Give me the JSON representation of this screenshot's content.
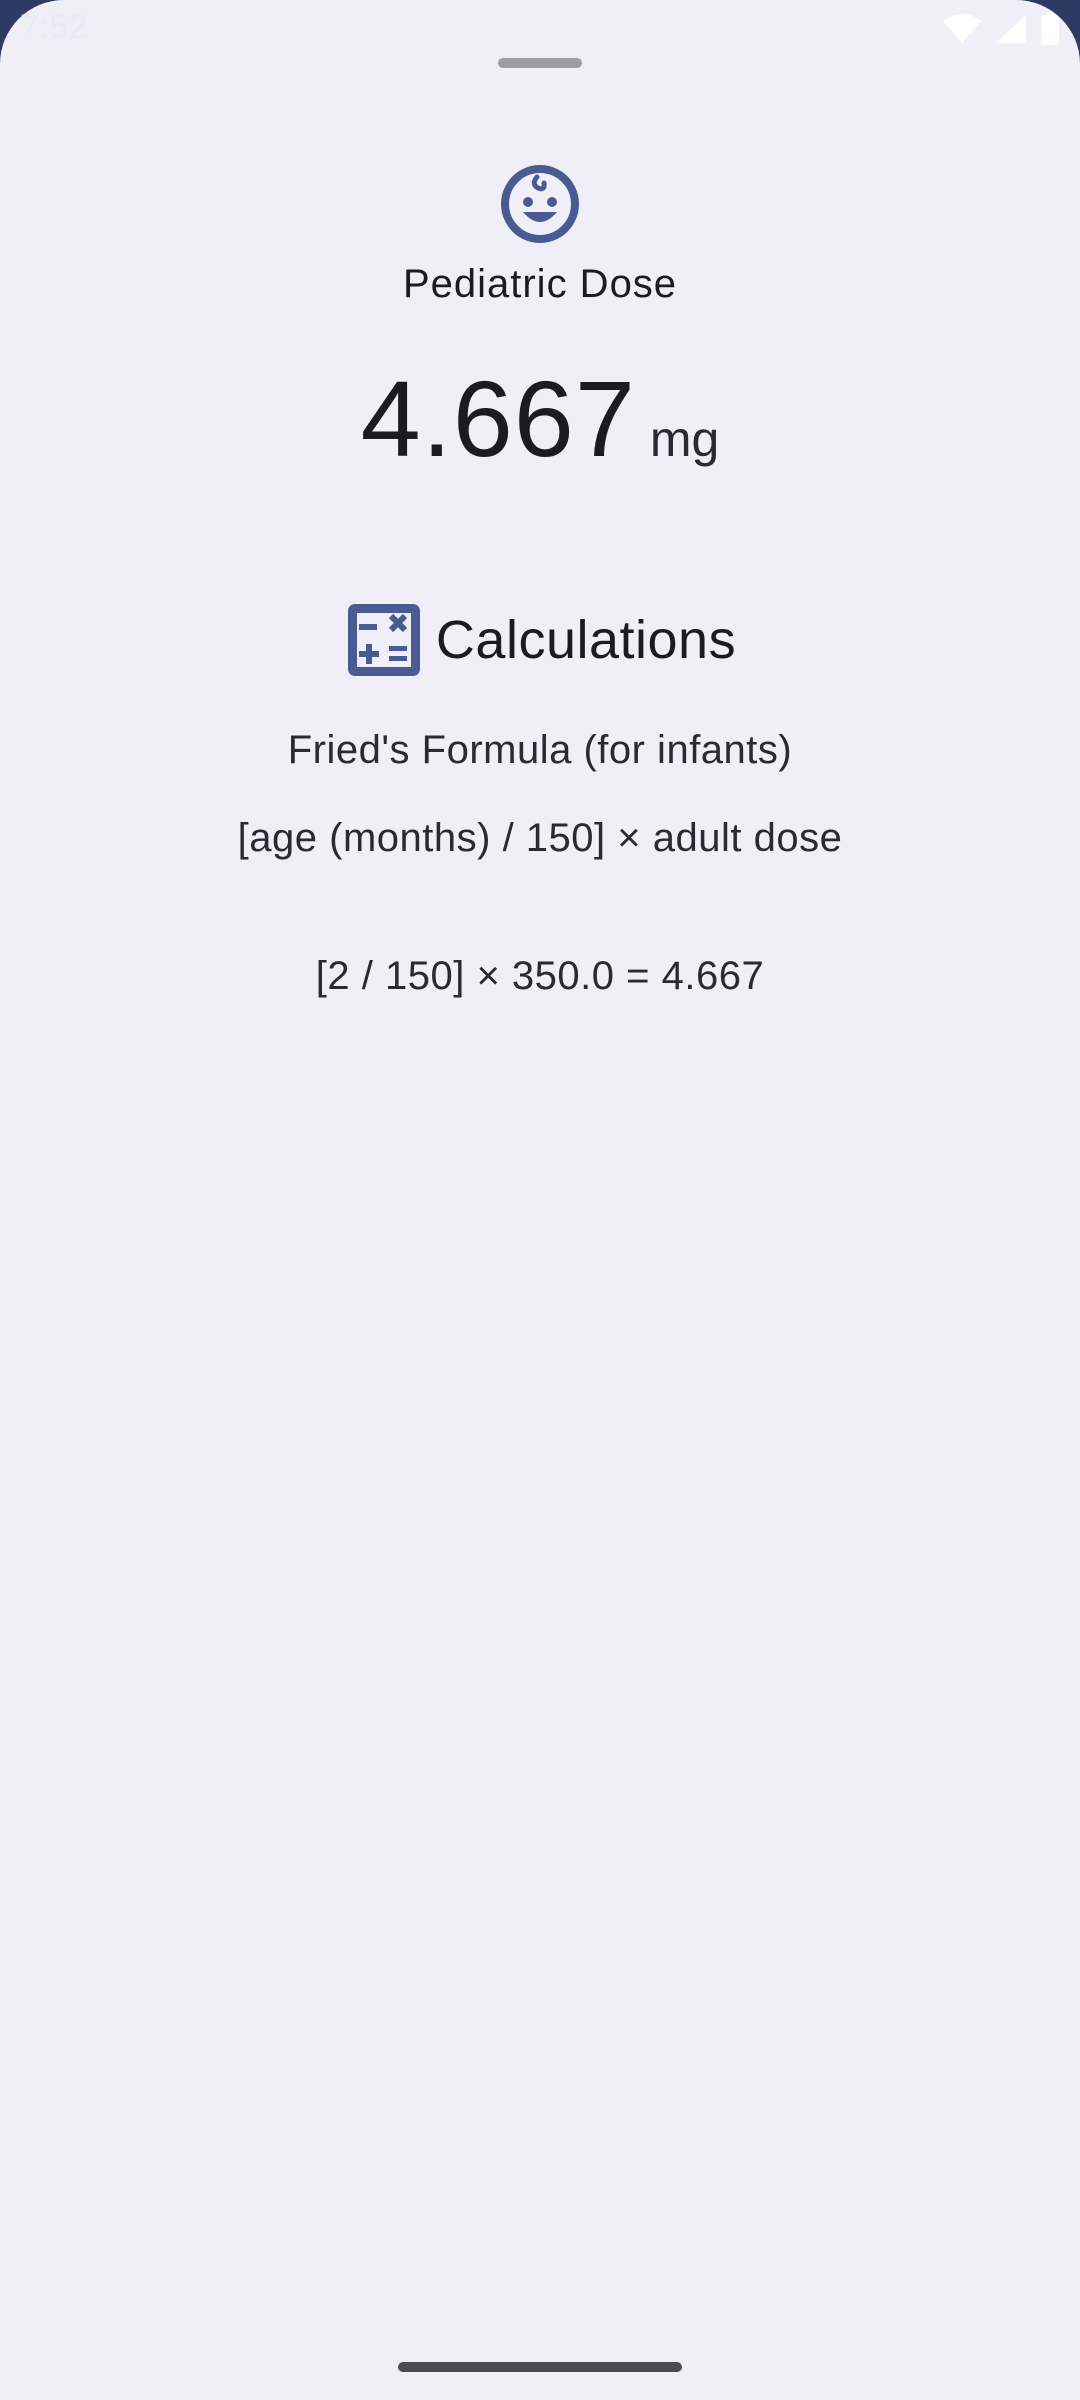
{
  "status_bar": {
    "time": "7:52",
    "icons": [
      "wifi-icon",
      "cellular-signal-icon",
      "battery-icon"
    ]
  },
  "sheet": {
    "icon": "baby-face-icon",
    "title": "Pediatric Dose",
    "result": {
      "value": "4.667",
      "unit": "mg"
    },
    "calculations": {
      "icon": "calculator-icon",
      "heading": "Calculations",
      "formula_name": "Fried's Formula (for infants)",
      "formula_expression": "[age (months) / 150] × adult dose",
      "formula_calculation": "[2 / 150] × 350.0 = 4.667"
    }
  },
  "colors": {
    "accent": "#4a5b94",
    "sheet_background": "#f0eff8",
    "status_bar_background": "#2d3a62",
    "text_primary": "#1c1b22"
  }
}
